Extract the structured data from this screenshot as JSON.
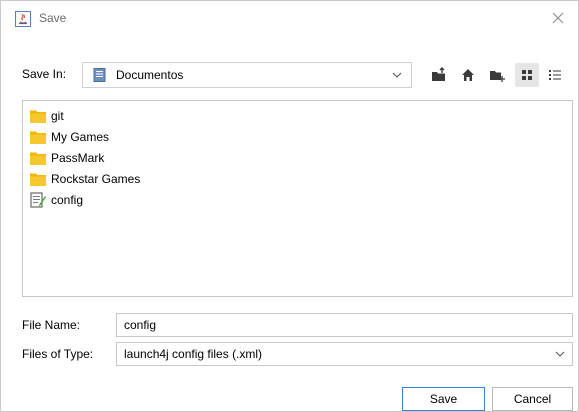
{
  "window": {
    "title": "Save"
  },
  "save_in": {
    "label": "Save In:",
    "value": "Documentos"
  },
  "files": [
    {
      "name": "git",
      "icon": "folder-icon"
    },
    {
      "name": "My Games",
      "icon": "folder-icon"
    },
    {
      "name": "PassMark",
      "icon": "folder-icon"
    },
    {
      "name": "Rockstar Games",
      "icon": "folder-icon"
    },
    {
      "name": "config",
      "icon": "text-file-icon"
    }
  ],
  "file_name": {
    "label": "File Name:",
    "value": "config"
  },
  "file_type": {
    "label": "Files of Type:",
    "value": "launch4j config files (.xml)"
  },
  "buttons": {
    "save": "Save",
    "cancel": "Cancel"
  },
  "colors": {
    "folder": "#f2b705",
    "accent": "#3c7fd8",
    "toolbar_icon": "#3a3a3a"
  }
}
